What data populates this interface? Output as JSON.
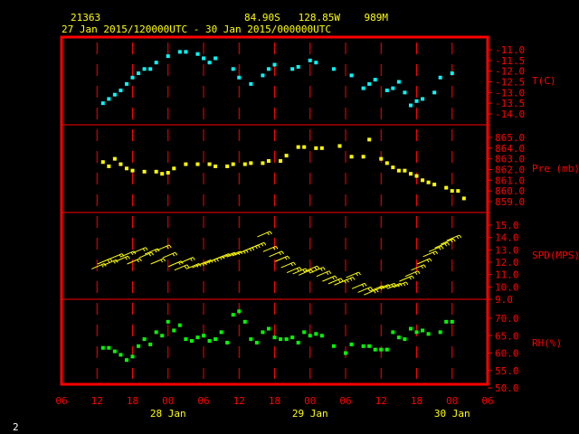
{
  "header": {
    "station": "21363",
    "location": "84.90S   128.85W    989M",
    "period": "27 Jan 2015/120000UTC - 30 Jan 2015/000000UTC"
  },
  "footer": {
    "page": "2"
  },
  "x_axis": {
    "hour_ticks": [
      6,
      12,
      18,
      24,
      30,
      36,
      42,
      48,
      54,
      60,
      66,
      72,
      78
    ],
    "hour_labels": [
      "06",
      "12",
      "18",
      "00",
      "06",
      "12",
      "18",
      "00",
      "06",
      "12",
      "18",
      "00",
      "06"
    ],
    "days": [
      {
        "label": "28 Jan",
        "center": 24
      },
      {
        "label": "29 Jan",
        "center": 48
      },
      {
        "label": "30 Jan",
        "center": 72
      }
    ]
  },
  "colors": {
    "background": "#000000",
    "frame": "#ff0000",
    "grid": "#ff0000",
    "axis_text": "#ff0000",
    "header_text": "#ffff00",
    "temperature": "#00ffff",
    "pressure": "#ffff00",
    "wind": "#ffff00",
    "humidity": "#00ff00",
    "page_text": "#ffffff"
  },
  "chart_data": [
    {
      "type": "scatter",
      "name": "temperature",
      "ylabel": "T(C)",
      "ylim": [
        -14.0,
        -11.0
      ],
      "yticks": [
        -11.0,
        -11.5,
        -12.0,
        -12.5,
        -13.0,
        -13.5,
        -14.0
      ],
      "ytick_labels": [
        "-11.0",
        "-11.5",
        "-12.0",
        "-12.5",
        "-13.0",
        "-13.5",
        "-14.0"
      ],
      "x": [
        13,
        14,
        15,
        16,
        17,
        18,
        19,
        20,
        21,
        22,
        24,
        26,
        27,
        29,
        30,
        31,
        32,
        35,
        36,
        38,
        40,
        41,
        42,
        45,
        46,
        48,
        49,
        52,
        55,
        57,
        58,
        59,
        61,
        62,
        63,
        64,
        65,
        66,
        67,
        69,
        70,
        72
      ],
      "y": [
        -13.5,
        -13.3,
        -13.1,
        -12.9,
        -12.6,
        -12.3,
        -12.1,
        -11.9,
        -11.9,
        -11.6,
        -11.3,
        -11.1,
        -11.1,
        -11.2,
        -11.4,
        -11.6,
        -11.4,
        -11.9,
        -12.3,
        -12.6,
        -12.2,
        -11.9,
        -11.7,
        -11.9,
        -11.8,
        -11.5,
        -11.6,
        -11.9,
        -12.2,
        -12.8,
        -12.6,
        -12.4,
        -12.9,
        -12.8,
        -12.5,
        -13.0,
        -13.6,
        -13.4,
        -13.3,
        -13.0,
        -12.3,
        -12.1
      ]
    },
    {
      "type": "scatter",
      "name": "pressure",
      "ylabel": "Pre (mb)",
      "ylim": [
        859.0,
        865.0
      ],
      "yticks": [
        865.0,
        864.0,
        863.0,
        862.0,
        861.0,
        860.0,
        859.0
      ],
      "ytick_labels": [
        "865.0",
        "864.0",
        "863.0",
        "862.0",
        "861.0",
        "860.0",
        "859.0"
      ],
      "x": [
        13,
        14,
        15,
        16,
        17,
        18,
        20,
        22,
        23,
        24,
        25,
        27,
        29,
        31,
        32,
        34,
        35,
        37,
        38,
        40,
        41,
        43,
        44,
        46,
        47,
        49,
        50,
        53,
        55,
        57,
        58,
        60,
        61,
        62,
        63,
        64,
        65,
        66,
        67,
        68,
        69,
        71,
        72,
        73,
        74
      ],
      "y": [
        862.7,
        862.3,
        863.0,
        862.5,
        862.1,
        861.9,
        861.8,
        861.8,
        861.6,
        861.7,
        862.1,
        862.5,
        862.5,
        862.5,
        862.3,
        862.3,
        862.5,
        862.5,
        862.6,
        862.6,
        862.8,
        862.8,
        863.3,
        864.1,
        864.1,
        864.0,
        864.0,
        864.2,
        863.2,
        863.2,
        864.8,
        863.0,
        862.6,
        862.2,
        861.9,
        861.9,
        861.6,
        861.4,
        861.0,
        860.8,
        860.6,
        860.3,
        860.0,
        860.0,
        859.3
      ]
    },
    {
      "type": "scatter",
      "name": "wind_speed",
      "ylabel": "SPD(MPS)",
      "ylim": [
        9.0,
        15.0
      ],
      "yticks": [
        15.0,
        14.0,
        13.0,
        12.0,
        11.0,
        10.0,
        9.0
      ],
      "ytick_labels": [
        "15.0",
        "14.0",
        "13.0",
        "12.0",
        "11.0",
        "10.0",
        "9.0"
      ],
      "x": [
        12,
        13,
        14,
        15,
        16,
        17,
        18,
        19,
        20,
        21,
        22,
        23,
        24,
        25,
        26,
        27,
        28,
        29,
        30,
        31,
        32,
        33,
        34,
        35,
        36,
        37,
        38,
        39,
        40,
        41,
        42,
        43,
        44,
        45,
        46,
        47,
        48,
        49,
        50,
        51,
        52,
        53,
        54,
        55,
        56,
        57,
        58,
        59,
        60,
        61,
        62,
        63,
        64,
        65,
        66,
        67,
        68,
        69,
        70,
        71,
        72
      ],
      "y": [
        11.6,
        12.0,
        11.9,
        12.4,
        12.2,
        12.6,
        12.0,
        12.9,
        12.5,
        12.8,
        12.0,
        13.1,
        12.5,
        11.8,
        11.5,
        12.1,
        11.6,
        11.7,
        11.9,
        12.0,
        12.2,
        12.4,
        12.5,
        12.6,
        12.7,
        12.9,
        13.1,
        13.3,
        14.2,
        13.0,
        12.6,
        12.2,
        11.7,
        11.3,
        11.2,
        11.1,
        11.4,
        11.3,
        11.0,
        10.6,
        10.4,
        10.3,
        10.5,
        10.9,
        10.0,
        9.7,
        9.5,
        9.8,
        9.9,
        10.0,
        10.0,
        10.1,
        10.6,
        11.0,
        11.5,
        12.0,
        12.6,
        13.0,
        13.3,
        13.6,
        13.9
      ]
    },
    {
      "type": "scatter",
      "name": "humidity",
      "ylabel": "RH(%)",
      "ylim": [
        50.0,
        70.0
      ],
      "yticks": [
        70.0,
        65.0,
        60.0,
        55.0,
        50.0
      ],
      "ytick_labels": [
        "70.0",
        "65.0",
        "60.0",
        "55.0",
        "50.0"
      ],
      "x": [
        13,
        14,
        15,
        16,
        17,
        18,
        19,
        20,
        21,
        22,
        23,
        24,
        25,
        26,
        27,
        28,
        29,
        30,
        31,
        32,
        33,
        34,
        35,
        36,
        37,
        38,
        39,
        40,
        41,
        42,
        43,
        44,
        45,
        46,
        47,
        48,
        49,
        50,
        52,
        54,
        55,
        57,
        58,
        59,
        60,
        61,
        62,
        63,
        64,
        65,
        66,
        67,
        68,
        70,
        71,
        72
      ],
      "y": [
        61.5,
        61.5,
        60.5,
        59.5,
        58.0,
        59.0,
        62.0,
        64.0,
        62.5,
        66.0,
        65.0,
        69.0,
        66.5,
        68.0,
        64.0,
        63.5,
        64.5,
        65.0,
        63.5,
        64.0,
        66.0,
        63.0,
        71.0,
        72.0,
        69.0,
        64.0,
        63.0,
        66.0,
        67.0,
        64.5,
        64.0,
        64.0,
        64.5,
        63.0,
        66.0,
        65.0,
        65.5,
        65.0,
        62.0,
        60.0,
        62.5,
        62.0,
        62.0,
        61.0,
        61.0,
        61.0,
        66.0,
        64.5,
        64.0,
        67.0,
        66.0,
        66.5,
        65.5,
        66.0,
        69.0,
        69.0
      ]
    }
  ]
}
